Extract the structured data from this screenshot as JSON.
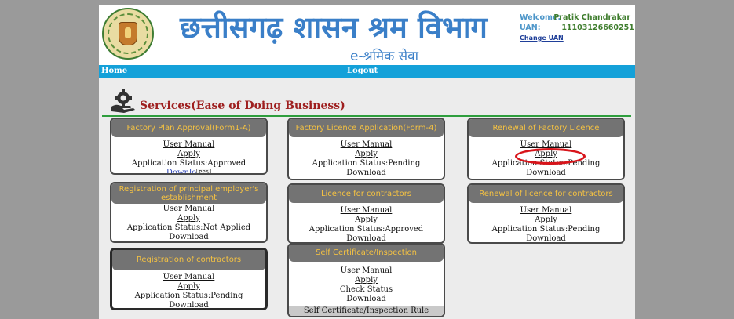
{
  "header": {
    "title_hindi": "छत्तीसगढ़ शासन श्रम विभाग",
    "subtitle_hindi": "e-श्रमिक सेवा",
    "welcome_label": "Welcome:",
    "user_name": "Pratik Chandrakar",
    "uan_label": "UAN:",
    "uan_value": "11103126660251",
    "change_uan": "Change UAN"
  },
  "nav": {
    "home": "Home",
    "logout": "Logout"
  },
  "section": {
    "title": "Services(Ease of Doing Business)"
  },
  "cards": {
    "c1": {
      "title": "Factory Plan Approval(Form1-A)",
      "user_manual": "User Manual",
      "apply": "Apply",
      "status": "Application Status:Approved",
      "download": "Downlo",
      "tooltip": "PP5"
    },
    "c2": {
      "title": "Factory Licence Application(Form-4)",
      "user_manual": "User Manual",
      "apply": "Apply",
      "status": "Application Status:Pending",
      "download": "Download"
    },
    "c3": {
      "title": "Renewal of Factory Licence",
      "user_manual": "User Manual",
      "apply": "Apply",
      "status": "Application Status:Pending",
      "download": "Download"
    },
    "c4": {
      "title": "Registration of principal employer's establishment",
      "user_manual": "User Manual",
      "apply": "Apply",
      "status": "Application Status:Not Applied",
      "download": "Download"
    },
    "c5": {
      "title": "Licence for contractors",
      "user_manual": "User Manual",
      "apply": "Apply",
      "status": "Application Status:Approved",
      "download": "Download"
    },
    "c6": {
      "title": "Renewal of licence for contractors",
      "user_manual": "User Manual",
      "apply": "Apply",
      "status": "Application Status:Pending",
      "download": "Download"
    },
    "c7": {
      "title": "Registration of contractors",
      "user_manual": "User Manual",
      "apply": "Apply",
      "status": "Application Status:Pending",
      "download": "Download"
    },
    "c8": {
      "title": "Self Certificate/Inspection",
      "user_manual": "User Manual",
      "apply": "Apply",
      "check_status": "Check Status",
      "download": "Download",
      "rule_link": "Self Certificate/Inspection Rule"
    }
  },
  "colors": {
    "header_blue": "#3a7fc8",
    "nav_bar": "#14a1d9",
    "card_header_bg": "#737373",
    "card_header_text": "#f5c242",
    "section_title": "#9e1f1f",
    "highlight_circle": "#d8141a"
  }
}
